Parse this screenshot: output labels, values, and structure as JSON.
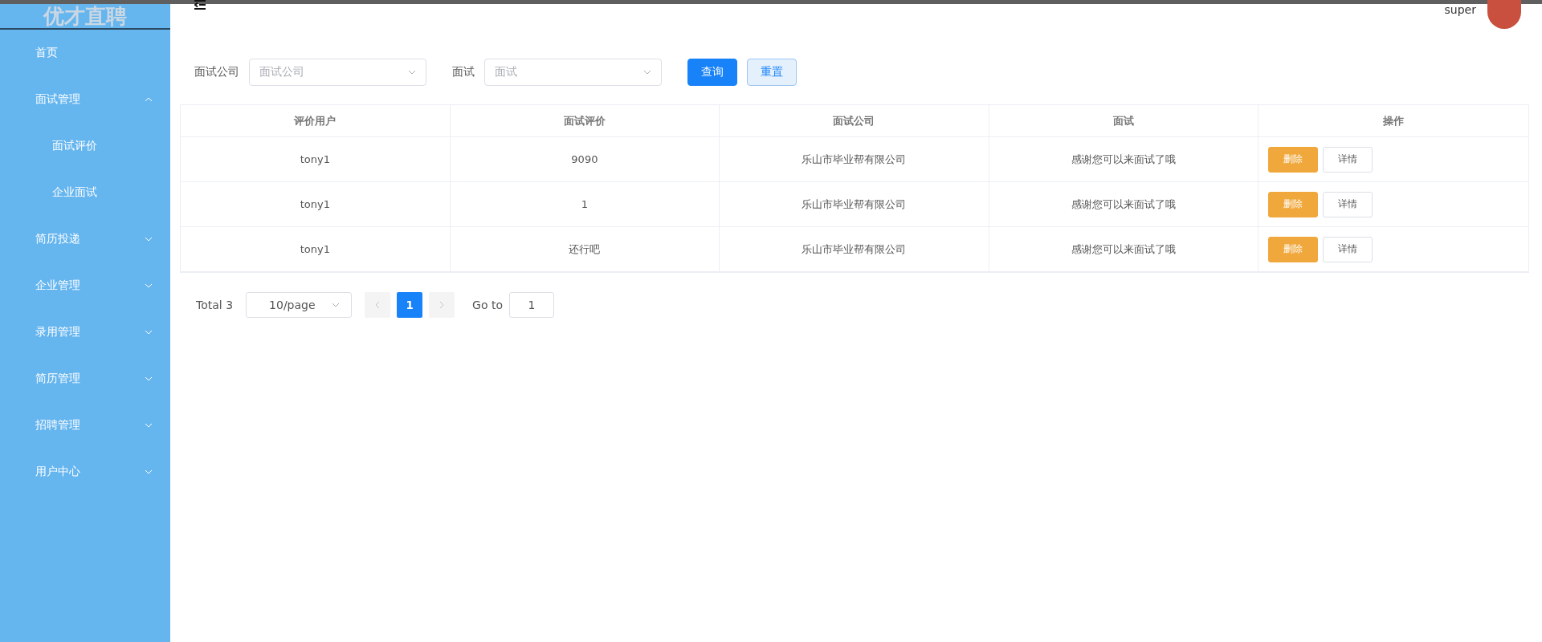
{
  "sidebar": {
    "logo": "优才直聘",
    "items": [
      {
        "label": "首页",
        "kind": "link"
      },
      {
        "label": "面试管理",
        "kind": "group",
        "expanded": true,
        "children": [
          {
            "label": "面试评价"
          },
          {
            "label": "企业面试"
          }
        ]
      },
      {
        "label": "简历投递",
        "kind": "group",
        "expanded": false
      },
      {
        "label": "企业管理",
        "kind": "group",
        "expanded": false
      },
      {
        "label": "录用管理",
        "kind": "group",
        "expanded": false
      },
      {
        "label": "简历管理",
        "kind": "group",
        "expanded": false
      },
      {
        "label": "招聘管理",
        "kind": "group",
        "expanded": false
      },
      {
        "label": "用户中心",
        "kind": "group",
        "expanded": false
      }
    ]
  },
  "header": {
    "user": "super"
  },
  "filters": [
    {
      "label": "面试公司",
      "placeholder": "面试公司"
    },
    {
      "label": "面试",
      "placeholder": "面试"
    }
  ],
  "buttons": [
    {
      "label": "查询",
      "kind": "primary"
    },
    {
      "label": "重置",
      "kind": "plain"
    }
  ],
  "table": {
    "columns": [
      "评价用户",
      "面试评价",
      "面试公司",
      "面试",
      "操作"
    ],
    "rows": [
      {
        "cells": [
          "tony1",
          "9090",
          "乐山市毕业帮有限公司",
          "感谢您可以来面试了哦"
        ],
        "actions": [
          "删除",
          "详情"
        ]
      },
      {
        "cells": [
          "tony1",
          "1",
          "乐山市毕业帮有限公司",
          "感谢您可以来面试了哦"
        ],
        "actions": [
          "删除",
          "详情"
        ]
      },
      {
        "cells": [
          "tony1",
          "还行吧",
          "乐山市毕业帮有限公司",
          "感谢您可以来面试了哦"
        ],
        "actions": [
          "删除",
          "详情"
        ]
      }
    ]
  },
  "pagination": {
    "total": "Total 3",
    "page_size": "10/page",
    "pages": [
      {
        "label": "1",
        "selected": true
      }
    ],
    "goto_label": "Go to",
    "goto_value": "1"
  }
}
